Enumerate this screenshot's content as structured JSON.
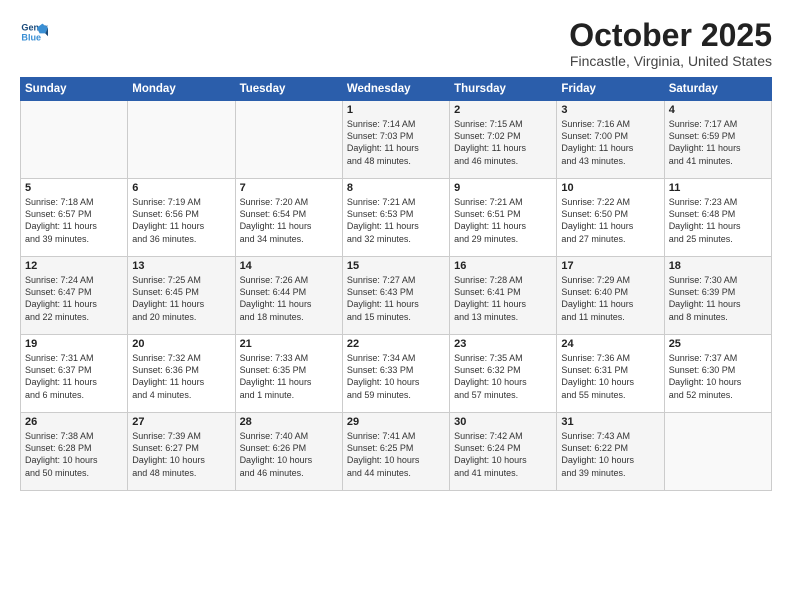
{
  "header": {
    "logo_line1": "General",
    "logo_line2": "Blue",
    "month": "October 2025",
    "location": "Fincastle, Virginia, United States"
  },
  "days_of_week": [
    "Sunday",
    "Monday",
    "Tuesday",
    "Wednesday",
    "Thursday",
    "Friday",
    "Saturday"
  ],
  "weeks": [
    [
      {
        "day": "",
        "content": ""
      },
      {
        "day": "",
        "content": ""
      },
      {
        "day": "",
        "content": ""
      },
      {
        "day": "1",
        "content": "Sunrise: 7:14 AM\nSunset: 7:03 PM\nDaylight: 11 hours\nand 48 minutes."
      },
      {
        "day": "2",
        "content": "Sunrise: 7:15 AM\nSunset: 7:02 PM\nDaylight: 11 hours\nand 46 minutes."
      },
      {
        "day": "3",
        "content": "Sunrise: 7:16 AM\nSunset: 7:00 PM\nDaylight: 11 hours\nand 43 minutes."
      },
      {
        "day": "4",
        "content": "Sunrise: 7:17 AM\nSunset: 6:59 PM\nDaylight: 11 hours\nand 41 minutes."
      }
    ],
    [
      {
        "day": "5",
        "content": "Sunrise: 7:18 AM\nSunset: 6:57 PM\nDaylight: 11 hours\nand 39 minutes."
      },
      {
        "day": "6",
        "content": "Sunrise: 7:19 AM\nSunset: 6:56 PM\nDaylight: 11 hours\nand 36 minutes."
      },
      {
        "day": "7",
        "content": "Sunrise: 7:20 AM\nSunset: 6:54 PM\nDaylight: 11 hours\nand 34 minutes."
      },
      {
        "day": "8",
        "content": "Sunrise: 7:21 AM\nSunset: 6:53 PM\nDaylight: 11 hours\nand 32 minutes."
      },
      {
        "day": "9",
        "content": "Sunrise: 7:21 AM\nSunset: 6:51 PM\nDaylight: 11 hours\nand 29 minutes."
      },
      {
        "day": "10",
        "content": "Sunrise: 7:22 AM\nSunset: 6:50 PM\nDaylight: 11 hours\nand 27 minutes."
      },
      {
        "day": "11",
        "content": "Sunrise: 7:23 AM\nSunset: 6:48 PM\nDaylight: 11 hours\nand 25 minutes."
      }
    ],
    [
      {
        "day": "12",
        "content": "Sunrise: 7:24 AM\nSunset: 6:47 PM\nDaylight: 11 hours\nand 22 minutes."
      },
      {
        "day": "13",
        "content": "Sunrise: 7:25 AM\nSunset: 6:45 PM\nDaylight: 11 hours\nand 20 minutes."
      },
      {
        "day": "14",
        "content": "Sunrise: 7:26 AM\nSunset: 6:44 PM\nDaylight: 11 hours\nand 18 minutes."
      },
      {
        "day": "15",
        "content": "Sunrise: 7:27 AM\nSunset: 6:43 PM\nDaylight: 11 hours\nand 15 minutes."
      },
      {
        "day": "16",
        "content": "Sunrise: 7:28 AM\nSunset: 6:41 PM\nDaylight: 11 hours\nand 13 minutes."
      },
      {
        "day": "17",
        "content": "Sunrise: 7:29 AM\nSunset: 6:40 PM\nDaylight: 11 hours\nand 11 minutes."
      },
      {
        "day": "18",
        "content": "Sunrise: 7:30 AM\nSunset: 6:39 PM\nDaylight: 11 hours\nand 8 minutes."
      }
    ],
    [
      {
        "day": "19",
        "content": "Sunrise: 7:31 AM\nSunset: 6:37 PM\nDaylight: 11 hours\nand 6 minutes."
      },
      {
        "day": "20",
        "content": "Sunrise: 7:32 AM\nSunset: 6:36 PM\nDaylight: 11 hours\nand 4 minutes."
      },
      {
        "day": "21",
        "content": "Sunrise: 7:33 AM\nSunset: 6:35 PM\nDaylight: 11 hours\nand 1 minute."
      },
      {
        "day": "22",
        "content": "Sunrise: 7:34 AM\nSunset: 6:33 PM\nDaylight: 10 hours\nand 59 minutes."
      },
      {
        "day": "23",
        "content": "Sunrise: 7:35 AM\nSunset: 6:32 PM\nDaylight: 10 hours\nand 57 minutes."
      },
      {
        "day": "24",
        "content": "Sunrise: 7:36 AM\nSunset: 6:31 PM\nDaylight: 10 hours\nand 55 minutes."
      },
      {
        "day": "25",
        "content": "Sunrise: 7:37 AM\nSunset: 6:30 PM\nDaylight: 10 hours\nand 52 minutes."
      }
    ],
    [
      {
        "day": "26",
        "content": "Sunrise: 7:38 AM\nSunset: 6:28 PM\nDaylight: 10 hours\nand 50 minutes."
      },
      {
        "day": "27",
        "content": "Sunrise: 7:39 AM\nSunset: 6:27 PM\nDaylight: 10 hours\nand 48 minutes."
      },
      {
        "day": "28",
        "content": "Sunrise: 7:40 AM\nSunset: 6:26 PM\nDaylight: 10 hours\nand 46 minutes."
      },
      {
        "day": "29",
        "content": "Sunrise: 7:41 AM\nSunset: 6:25 PM\nDaylight: 10 hours\nand 44 minutes."
      },
      {
        "day": "30",
        "content": "Sunrise: 7:42 AM\nSunset: 6:24 PM\nDaylight: 10 hours\nand 41 minutes."
      },
      {
        "day": "31",
        "content": "Sunrise: 7:43 AM\nSunset: 6:22 PM\nDaylight: 10 hours\nand 39 minutes."
      },
      {
        "day": "",
        "content": ""
      }
    ]
  ]
}
